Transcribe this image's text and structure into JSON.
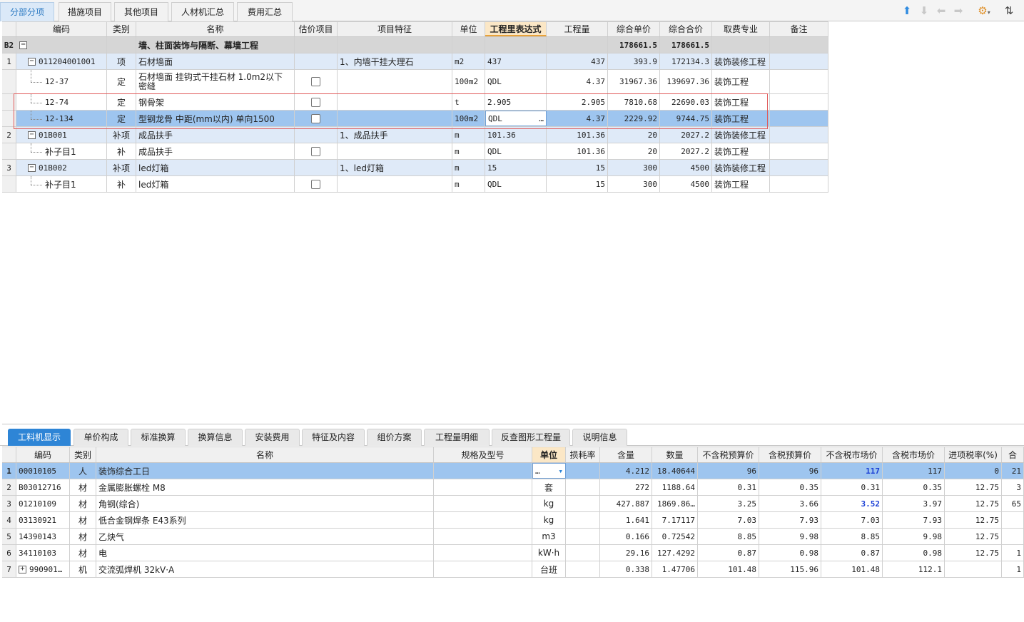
{
  "top_tabs": [
    "分部分项",
    "措施项目",
    "其他项目",
    "人材机汇总",
    "费用汇总"
  ],
  "toolbar_icons": [
    "arrow-up-icon",
    "arrow-down-icon",
    "arrow-left-icon",
    "arrow-right-icon",
    "settings-icon",
    "sort-icon"
  ],
  "upper_headers": [
    "编码",
    "类别",
    "名称",
    "估价项目",
    "项目特征",
    "单位",
    "工程里表达式",
    "工程量",
    "综合单价",
    "综合合价",
    "取费专业",
    "备注"
  ],
  "upper_rows": [
    {
      "num": "B2",
      "code": "",
      "type": "",
      "name": "墙、柱面装饰与隔断、幕墙工程",
      "spec": "",
      "unit": "",
      "expr": "",
      "qty": "",
      "price": "178661.5",
      "total": "178661.5",
      "fee": "",
      "note": ""
    },
    {
      "num": "1",
      "code": "011204001001",
      "type": "项",
      "name": "石材墙面",
      "spec": "1、内墙干挂大理石",
      "unit": "m2",
      "expr": "437",
      "qty": "437",
      "price": "393.9",
      "total": "172134.3",
      "fee": "装饰装修工程",
      "note": ""
    },
    {
      "num": "",
      "code": "12-37",
      "type": "定",
      "name": "石材墙面 挂钩式干挂石材 1.0m2以下 密缝",
      "spec": "",
      "unit": "100m2",
      "expr": "QDL",
      "qty": "4.37",
      "price": "31967.36",
      "total": "139697.36",
      "fee": "装饰工程",
      "note": ""
    },
    {
      "num": "",
      "code": "12-74",
      "type": "定",
      "name": "钢骨架",
      "spec": "",
      "unit": "t",
      "expr": "2.905",
      "qty": "2.905",
      "price": "7810.68",
      "total": "22690.03",
      "fee": "装饰工程",
      "note": ""
    },
    {
      "num": "",
      "code": "12-134",
      "type": "定",
      "name": "型钢龙骨 中距(mm以内) 单向1500",
      "spec": "",
      "unit": "100m2",
      "expr": "QDL",
      "qty": "4.37",
      "price": "2229.92",
      "total": "9744.75",
      "fee": "装饰工程",
      "note": ""
    },
    {
      "num": "2",
      "code": "01B001",
      "type": "补项",
      "name": "成品扶手",
      "spec": "1、成品扶手",
      "unit": "m",
      "expr": "101.36",
      "qty": "101.36",
      "price": "20",
      "total": "2027.2",
      "fee": "装饰装修工程",
      "note": ""
    },
    {
      "num": "",
      "code": "补子目1",
      "type": "补",
      "name": "成品扶手",
      "spec": "",
      "unit": "m",
      "expr": "QDL",
      "qty": "101.36",
      "price": "20",
      "total": "2027.2",
      "fee": "装饰工程",
      "note": ""
    },
    {
      "num": "3",
      "code": "01B002",
      "type": "补项",
      "name": "led灯箱",
      "spec": "1、led灯箱",
      "unit": "m",
      "expr": "15",
      "qty": "15",
      "price": "300",
      "total": "4500",
      "fee": "装饰装修工程",
      "note": ""
    },
    {
      "num": "",
      "code": "补子目1",
      "type": "补",
      "name": "led灯箱",
      "spec": "",
      "unit": "m",
      "expr": "QDL",
      "qty": "15",
      "price": "300",
      "total": "4500",
      "fee": "装饰工程",
      "note": ""
    }
  ],
  "ellipsis": "…",
  "bottom_tabs": [
    "工料机显示",
    "单价构成",
    "标准换算",
    "换算信息",
    "安装费用",
    "特征及内容",
    "组价方案",
    "工程量明细",
    "反查图形工程量",
    "说明信息"
  ],
  "lower_headers": [
    "编码",
    "类别",
    "名称",
    "规格及型号",
    "单位",
    "损耗率",
    "含量",
    "数量",
    "不含税预算价",
    "含税预算价",
    "不含税市场价",
    "含税市场价",
    "进项税率(%)",
    "合"
  ],
  "lower_rows": [
    {
      "num": "1",
      "code": "00010105",
      "type": "人",
      "name": "装饰综合工日",
      "spec": "",
      "unit": "…",
      "loss": "",
      "content": "4.212",
      "qty": "18.40644",
      "p1": "96",
      "p2": "96",
      "p3": "117",
      "p4": "117",
      "tax": "0",
      "last": "21"
    },
    {
      "num": "2",
      "code": "B03012716",
      "type": "材",
      "name": "金属膨胀螺栓 M8",
      "spec": "",
      "unit": "套",
      "loss": "",
      "content": "272",
      "qty": "1188.64",
      "p1": "0.31",
      "p2": "0.35",
      "p3": "0.31",
      "p4": "0.35",
      "tax": "12.75",
      "last": "3"
    },
    {
      "num": "3",
      "code": "01210109",
      "type": "材",
      "name": "角钢(综合)",
      "spec": "",
      "unit": "kg",
      "loss": "",
      "content": "427.887",
      "qty": "1869.86…",
      "p1": "3.25",
      "p2": "3.66",
      "p3": "3.52",
      "p4": "3.97",
      "tax": "12.75",
      "last": "65"
    },
    {
      "num": "4",
      "code": "03130921",
      "type": "材",
      "name": "低合金钢焊条 E43系列",
      "spec": "",
      "unit": "kg",
      "loss": "",
      "content": "1.641",
      "qty": "7.17117",
      "p1": "7.03",
      "p2": "7.93",
      "p3": "7.03",
      "p4": "7.93",
      "tax": "12.75",
      "last": ""
    },
    {
      "num": "5",
      "code": "14390143",
      "type": "材",
      "name": "乙炔气",
      "spec": "",
      "unit": "m3",
      "loss": "",
      "content": "0.166",
      "qty": "0.72542",
      "p1": "8.85",
      "p2": "9.98",
      "p3": "8.85",
      "p4": "9.98",
      "tax": "12.75",
      "last": ""
    },
    {
      "num": "6",
      "code": "34110103",
      "type": "材",
      "name": "电",
      "spec": "",
      "unit": "kW·h",
      "loss": "",
      "content": "29.16",
      "qty": "127.4292",
      "p1": "0.87",
      "p2": "0.98",
      "p3": "0.87",
      "p4": "0.98",
      "tax": "12.75",
      "last": "1"
    },
    {
      "num": "7",
      "code": "990901…",
      "type": "机",
      "name": "交流弧焊机 32kV·A",
      "spec": "",
      "unit": "台班",
      "loss": "",
      "content": "0.338",
      "qty": "1.47706",
      "p1": "101.48",
      "p2": "115.96",
      "p3": "101.48",
      "p4": "112.1",
      "tax": "",
      "last": "1"
    }
  ]
}
